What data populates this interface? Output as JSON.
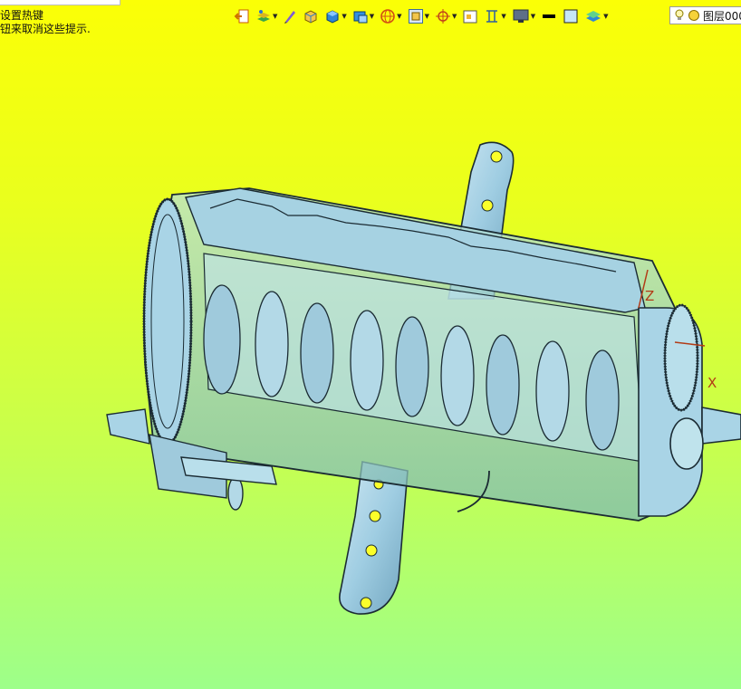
{
  "hints": {
    "line1": "设置热键",
    "line2": "钮来取消这些提示."
  },
  "toolbar": {
    "icons": [
      "exit-icon",
      "layer-manager-icon",
      "pen-icon",
      "cube-wire-icon",
      "cube-shaded-icon",
      "view-cube-icon",
      "sphere-icon",
      "frame-icon",
      "snap-target-icon",
      "grid-icon",
      "dimension-icon",
      "monitor-icon",
      "line-weight-icon",
      "color-swatch-icon",
      "layer-stack-icon"
    ]
  },
  "layer": {
    "name": "图层000"
  },
  "axes": {
    "z": "Z",
    "x": "X"
  },
  "colors": {
    "background_top": "#fbff06",
    "background_bottom": "#9dff8a",
    "model_face": "#a9d4e6",
    "model_edge": "#1b2b33",
    "axis": "#b23b16"
  }
}
